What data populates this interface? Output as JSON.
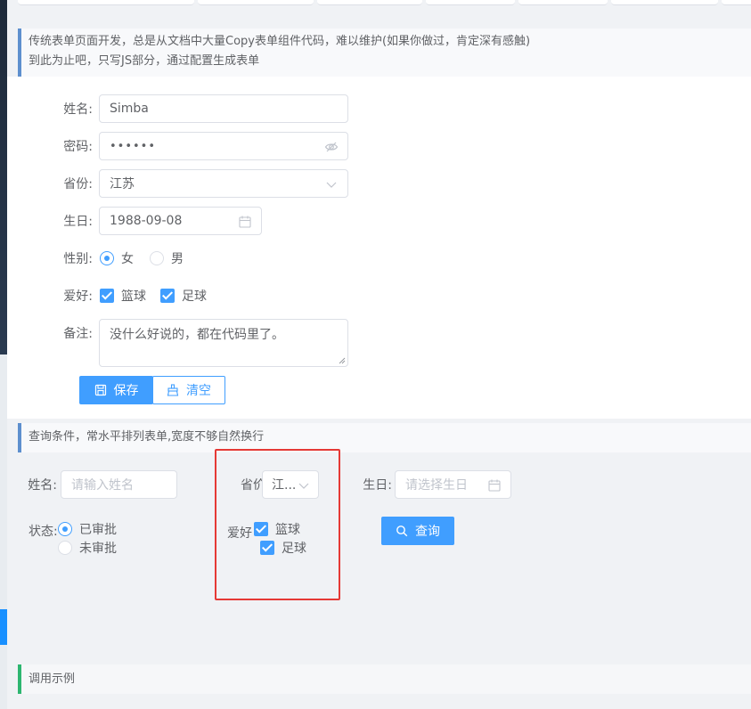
{
  "tip1": {
    "line1": "传统表单页面开发，总是从文档中大量Copy表单组件代码，难以维护(如果你做过，肯定深有感触)",
    "line2": "到此为止吧，只写JS部分，通过配置生成表单"
  },
  "form": {
    "name_label": "姓名:",
    "name_value": "Simba",
    "password_label": "密码:",
    "password_value": "••••••",
    "province_label": "省份:",
    "province_value": "江苏",
    "birthday_label": "生日:",
    "birthday_value": "1988-09-08",
    "gender_label": "性别:",
    "gender_options": [
      "女",
      "男"
    ],
    "hobby_label": "爱好:",
    "hobby_options": [
      "篮球",
      "足球"
    ],
    "remark_label": "备注:",
    "remark_value": "没什么好说的，都在代码里了。",
    "save_label": "保存",
    "clear_label": "清空"
  },
  "tip2": {
    "text": "查询条件，常水平排列表单,宽度不够自然换行"
  },
  "query": {
    "name_label": "姓名:",
    "name_placeholder": "请输入姓名",
    "province_label": "省份",
    "province_label_visible": "省价",
    "province_value": "江...",
    "birthday_label": "生日:",
    "birthday_placeholder": "请选择生日",
    "status_label": "状态:",
    "status_options": [
      "已审批",
      "未审批"
    ],
    "hobby_label": "爱好",
    "hobby_options": [
      "篮球",
      "足球"
    ],
    "search_label": "查询"
  },
  "tip3": {
    "text": "调用示例"
  },
  "colors": {
    "primary": "#409eff",
    "highlight": "#e53935"
  }
}
